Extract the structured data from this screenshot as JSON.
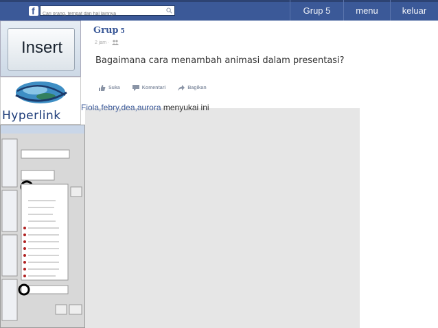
{
  "topbar": {
    "search_placeholder": "Cari orang, tempat dan hal lainnya",
    "nav": [
      "Grup 5",
      "menu",
      "keluar"
    ]
  },
  "slides": {
    "insert_label": "Insert",
    "hyperlink_label": "Hyperlink"
  },
  "post": {
    "group_name": "Grup",
    "group_number": "5",
    "time": "2 jam ·",
    "question": "Bagaimana cara menambah animasi dalam presentasi?",
    "actions": [
      "Suka",
      "Komentari",
      "Bagikan"
    ],
    "liked_by": "Fiola,febry,dea,aurora",
    "liked_suffix": " menyukai ini"
  },
  "colors": {
    "topbar": "#3b5998",
    "link": "#3b5998",
    "panel": "#e6e6e6"
  },
  "icons": [
    "facebook-logo-icon",
    "search-icon",
    "people-icon",
    "like-icon",
    "comment-icon",
    "share-icon",
    "globe-icon"
  ]
}
